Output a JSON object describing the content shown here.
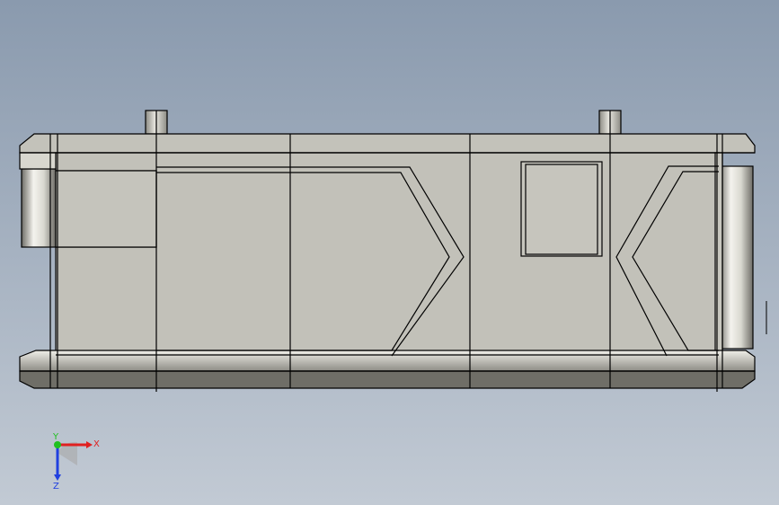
{
  "view": {
    "background_top": "#8a9aae",
    "background_bottom": "#c2cad4",
    "part_face_color": "#c3c2ba",
    "part_shadow_color": "#6f6e67",
    "edge_color": "#000000"
  },
  "triad": {
    "x_label": "X",
    "y_label": "Y",
    "z_label": "Z",
    "x_color": "#e02020",
    "y_color": "#20c020",
    "z_color": "#2040e0"
  }
}
